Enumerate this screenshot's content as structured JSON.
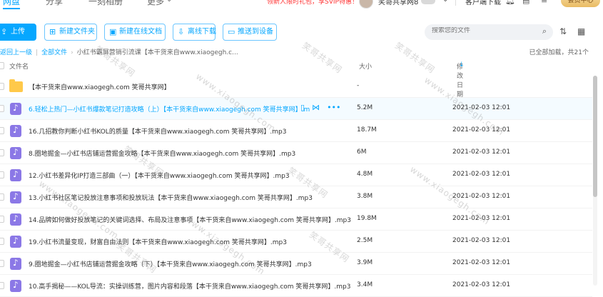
{
  "top_nav": {
    "tabs": [
      {
        "label": "网盘",
        "active": true
      },
      {
        "label": "分享"
      },
      {
        "label": "一刻相册"
      },
      {
        "label": "更多"
      }
    ],
    "promo_text": "领新人限时礼包，享SVIP特惠！",
    "username": "笑哥共享网8",
    "client_download": "客户端下载",
    "member_center": "会员中心"
  },
  "toolbar": {
    "upload": "上传",
    "new_folder": "新建文件夹",
    "new_online_doc": "新建在线文档",
    "offline_download": "离线下载",
    "push_to_device": "推送到设备",
    "search_placeholder": "搜索您的文件"
  },
  "breadcrumb": {
    "back": "返回上一级",
    "all_files": "全部文件",
    "current": "小红书霸屏营销引流课【本干货来自www.xiaogegh.c..."
  },
  "load_status": "已全部加载，共21个",
  "table": {
    "col_name": "文件名",
    "col_size": "大小",
    "col_modified": "修改日期",
    "rows": [
      {
        "type": "folder",
        "name": "【本干货来自www.xiaogegh.com 笑哥共享网】",
        "size": "-",
        "date": ""
      },
      {
        "type": "audio",
        "name": "6.轻松上热门—小红书爆款笔记打造攻略（上）【本干货来自www.xiaogegh.com 笑哥共享网】.m",
        "size": "5.2M",
        "date": "2021-02-03 12:01",
        "hover": true
      },
      {
        "type": "audio",
        "name": "16.几招教你判断小红书KOL的质量【本干货来自www.xiaogegh.com 笑哥共享网】.mp3",
        "size": "18.7M",
        "date": "2021-02-03 12:01"
      },
      {
        "type": "audio",
        "name": "8.圈地掘金—小红书店铺运营掘金攻略【本干货来自www.xiaogegh.com 笑哥共享网】.mp3",
        "size": "6M",
        "date": "2021-02-03 12:01"
      },
      {
        "type": "audio",
        "name": "12.小红书差异化IP打造三部曲（一）【本干货来自www.xiaogegh.com 笑哥共享网】.mp3",
        "size": "4.8M",
        "date": "2021-02-03 12:01"
      },
      {
        "type": "audio",
        "name": "13.小红书社区笔记投放注意事项和投放玩法【本干货来自www.xiaogegh.com 笑哥共享网】.mp3",
        "size": "3.8M",
        "date": "2021-02-03 12:01"
      },
      {
        "type": "audio",
        "name": "14.品牌如何做好投放笔记的关键词选择、布局及注意事项【本干货来自www.xiaogegh.com 笑哥共享网】.mp3",
        "size": "19.8M",
        "date": "2021-02-03 12:01"
      },
      {
        "type": "audio",
        "name": "19.小红书流量变现，财富自由法则【本干货来自www.xiaogegh.com 笑哥共享网】.mp3",
        "size": "2.5M",
        "date": "2021-02-03 12:01"
      },
      {
        "type": "audio",
        "name": "9.圈地掘金—小红书店铺运营掘金攻略（下）【本干货来自www.xiaogegh.com 笑哥共享网】.mp3",
        "size": "3.9M",
        "date": "2021-02-03 12:01"
      },
      {
        "type": "audio",
        "name": "10.高手揭秘——KOL导流：实操训练营，图片内容和段落【本干货来自www.xiaogegh.com 笑哥共享网】.mp3",
        "size": "3.4M",
        "date": "2021-02-03 12:01"
      }
    ]
  },
  "watermark": {
    "site": "www.xiaogegh.com",
    "name": "笑哥共享网"
  },
  "colors": {
    "accent": "#06a7ff",
    "audio_icon": "#8b78e6",
    "folder_icon": "#ffc94a",
    "promo": "#ff3333"
  }
}
